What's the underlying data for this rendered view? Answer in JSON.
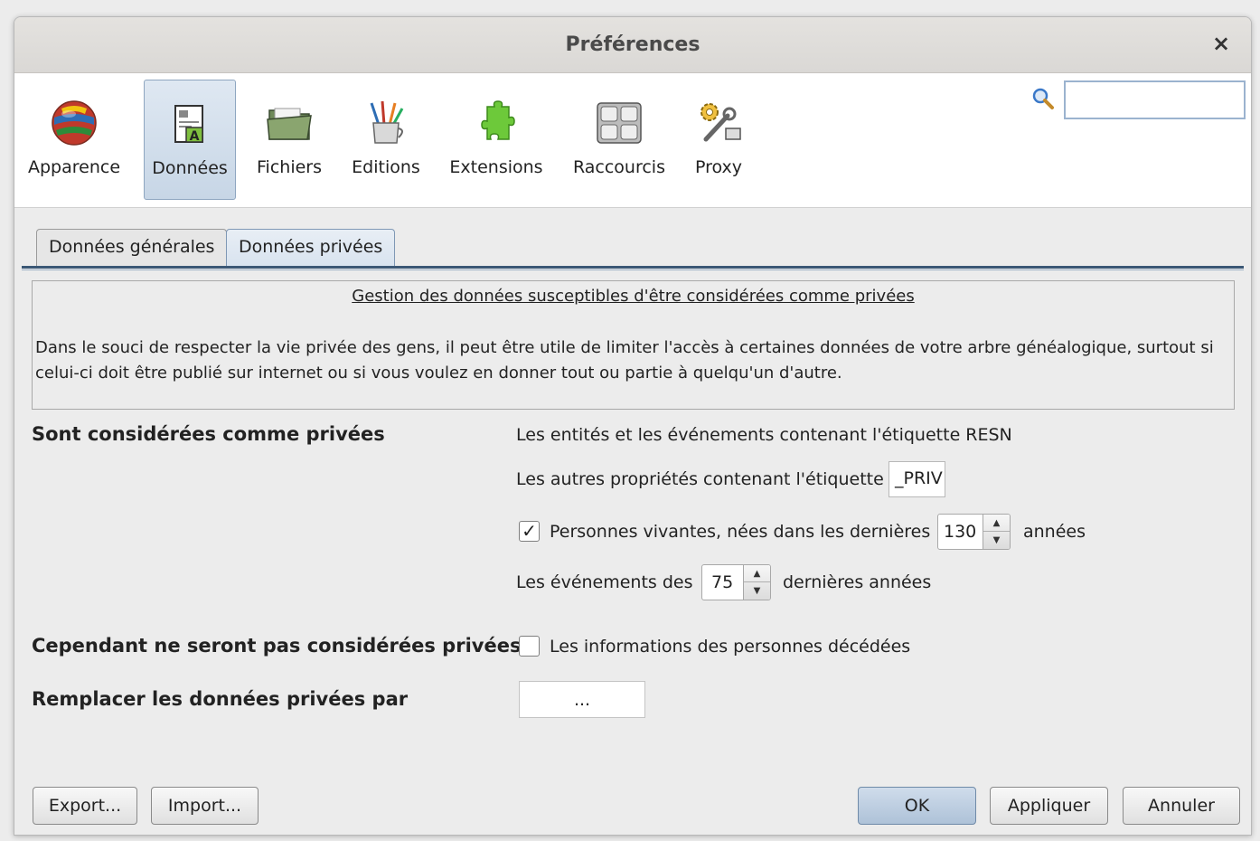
{
  "window": {
    "title": "Préférences",
    "close_glyph": "×"
  },
  "toolbar": {
    "items": [
      {
        "label": "Apparence",
        "icon": "globe-flags-icon"
      },
      {
        "label": "Données",
        "icon": "document-data-icon",
        "selected": true
      },
      {
        "label": "Fichiers",
        "icon": "folder-icon"
      },
      {
        "label": "Editions",
        "icon": "pencil-cup-icon"
      },
      {
        "label": "Extensions",
        "icon": "puzzle-piece-icon"
      },
      {
        "label": "Raccourcis",
        "icon": "keyboard-keys-icon"
      },
      {
        "label": "Proxy",
        "icon": "gear-wrench-icon"
      }
    ],
    "search": {
      "placeholder": "",
      "value": ""
    }
  },
  "tabs": [
    {
      "label": "Données générales",
      "active": false
    },
    {
      "label": "Données privées",
      "active": true
    }
  ],
  "info": {
    "title": "Gestion des données susceptibles d'être considérées comme privées",
    "text": "Dans le souci de respecter la vie privée des gens, il peut être utile de limiter l'accès à certaines données de votre arbre généalogique, surtout si celui-ci doit être publié sur internet ou si vous voulez en donner tout ou partie à quelqu'un d'autre."
  },
  "private": {
    "section_label": "Sont considérées comme privées",
    "resn_text": "Les entités et les événements contenant l'étiquette RESN",
    "other_props_label": "Les autres propriétés contenant l'étiquette",
    "other_props_value": "_PRIV",
    "living": {
      "checked": true,
      "check_glyph": "✓",
      "label": "Personnes vivantes, nées dans les dernières",
      "value": "130",
      "unit": "années"
    },
    "events": {
      "label_before": "Les événements des",
      "value": "75",
      "label_after": "dernières années"
    }
  },
  "not_private": {
    "section_label": "Cependant ne seront pas considérées privées",
    "deceased": {
      "checked": false,
      "label": "Les informations des personnes décédées"
    }
  },
  "replace": {
    "section_label": "Remplacer les données privées par",
    "value": "..."
  },
  "buttons": {
    "export": "Export...",
    "import": "Import...",
    "ok": "OK",
    "apply": "Appliquer",
    "cancel": "Annuler"
  },
  "colors": {
    "accent": "#3b5876",
    "selected_bg": "#c7d6e6"
  }
}
